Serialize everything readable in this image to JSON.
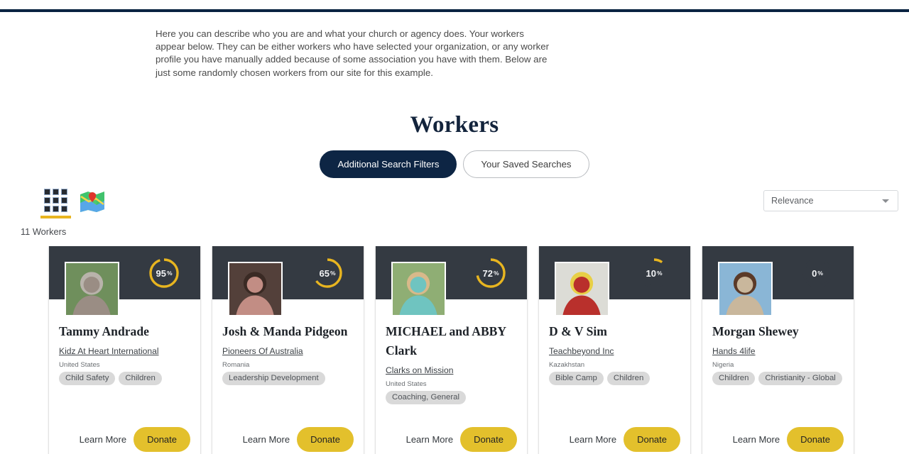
{
  "intro": {
    "paragraph": "Here you can describe who you are and what your church or agency does. Your workers appear below. They can be either workers who have selected your organization, or any worker profile you have manually added because of some association you have with them. Below are just some randomly chosen workers from our site for this example."
  },
  "header": {
    "title": "Workers",
    "filters_button": "Additional Search Filters",
    "saved_searches_button": "Your Saved Searches"
  },
  "toolbar": {
    "grid_view_icon": "grid-view-icon",
    "map_view_icon": "map-view-icon",
    "count_label": "11 Workers",
    "sort_value": "Relevance",
    "sort_caret_icon": "chevron-down-icon"
  },
  "colors": {
    "navy": "#0a2341",
    "gold": "#e8b520",
    "card_header": "#343a42",
    "donate": "#e3c02c",
    "tag_bg": "#d9d9d9"
  },
  "cards": [
    {
      "name": "Tammy Andrade",
      "percent": 95,
      "percent_label": "95",
      "percent_suffix": "%",
      "org": "Kidz At Heart International",
      "country": "United States",
      "tags": [
        "Child Safety",
        "Children"
      ],
      "learn_more": "Learn More",
      "donate": "Donate"
    },
    {
      "name": "Josh & Manda Pidgeon",
      "percent": 65,
      "percent_label": "65",
      "percent_suffix": "%",
      "org": "Pioneers Of Australia",
      "country": "Romania",
      "tags": [
        "Leadership Development"
      ],
      "learn_more": "Learn More",
      "donate": "Donate"
    },
    {
      "name": "MICHAEL and ABBY Clark",
      "percent": 72,
      "percent_label": "72",
      "percent_suffix": "%",
      "org": "Clarks on Mission",
      "country": "United States",
      "tags": [
        "Coaching, General"
      ],
      "learn_more": "Learn More",
      "donate": "Donate"
    },
    {
      "name": "D & V Sim",
      "percent": 10,
      "percent_label": "10",
      "percent_suffix": "%",
      "org": "Teachbeyond Inc",
      "country": "Kazakhstan",
      "tags": [
        "Bible Camp",
        "Children"
      ],
      "learn_more": "Learn More",
      "donate": "Donate"
    },
    {
      "name": "Morgan Shewey",
      "percent": 0,
      "percent_label": "0",
      "percent_suffix": "%",
      "org": "Hands 4life",
      "country": "Nigeria",
      "tags": [
        "Children",
        "Christianity - Global"
      ],
      "learn_more": "Learn More",
      "donate": "Donate"
    }
  ]
}
